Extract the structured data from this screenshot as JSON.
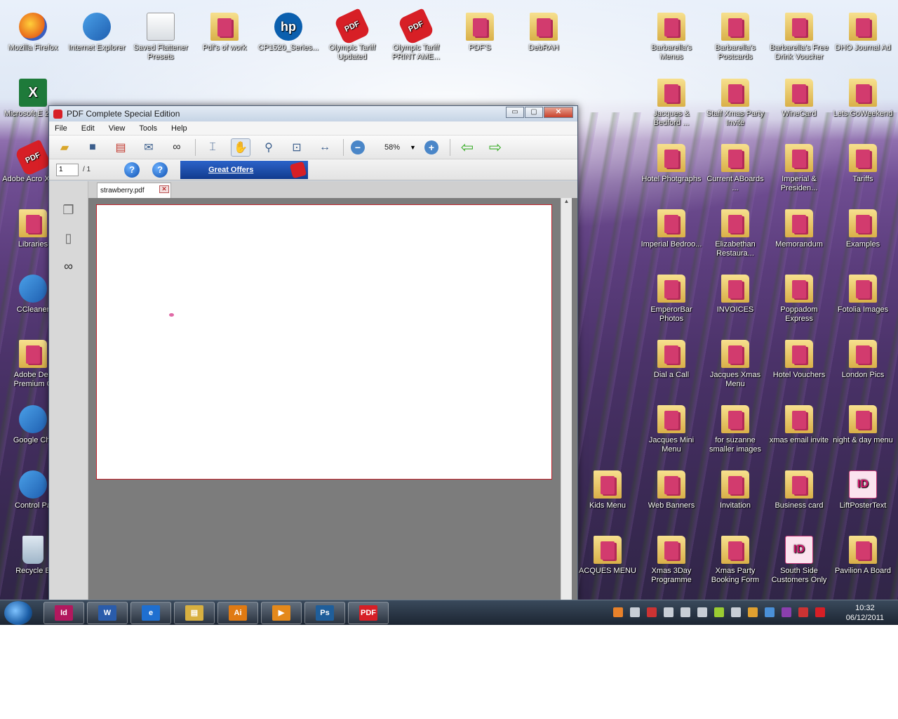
{
  "window": {
    "title": "PDF Complete Special Edition",
    "menu": [
      "File",
      "Edit",
      "View",
      "Tools",
      "Help"
    ],
    "zoom": "58%",
    "page_number": "1",
    "page_total": "/ 1",
    "offers_label": "Great Offers",
    "tab_name": "strawberry.pdf",
    "close_glyph": "✕",
    "min_glyph": "▭",
    "max_glyph": "▢"
  },
  "desktop_icons": [
    {
      "label": "Mozilla Firefox",
      "kind": "ff"
    },
    {
      "label": "Internet Explorer",
      "kind": "app"
    },
    {
      "label": "Saved Flattener Presets",
      "kind": "gen"
    },
    {
      "label": "Pdf's of work",
      "kind": "folder"
    },
    {
      "label": "CP1520_Series...",
      "kind": "hp"
    },
    {
      "label": "Olympic Tariff Updated",
      "kind": "pdf"
    },
    {
      "label": "Olympic Tariff PRINT AME...",
      "kind": "pdf"
    },
    {
      "label": "PDF'S",
      "kind": "folder"
    },
    {
      "label": "DebRAH",
      "kind": "folder"
    },
    {
      "label": "Barbarella's Menus",
      "kind": "folder"
    },
    {
      "label": "Barbarella's Postcards",
      "kind": "folder"
    },
    {
      "label": "Barbarella's Free Drink Voucher",
      "kind": "folder"
    },
    {
      "label": "DHO Journal Ad",
      "kind": "folder"
    },
    {
      "label": "Microsoft E 2010",
      "kind": "xl"
    },
    {
      "label": "Jacques & Bedford ...",
      "kind": "folder"
    },
    {
      "label": "Staff Xmas Party Invite",
      "kind": "folder"
    },
    {
      "label": "WineCard",
      "kind": "folder"
    },
    {
      "label": "Lets GoWeekend",
      "kind": "folder"
    },
    {
      "label": "Adobe Acro X Pro",
      "kind": "pdf"
    },
    {
      "label": "Hotel Photgraphs",
      "kind": "folder"
    },
    {
      "label": "Current ABoards ...",
      "kind": "folder"
    },
    {
      "label": "Imperial & Presiden...",
      "kind": "folder"
    },
    {
      "label": "Tariffs",
      "kind": "folder"
    },
    {
      "label": "Libraries",
      "kind": "folder"
    },
    {
      "label": "Imperial Bedroo...",
      "kind": "folder"
    },
    {
      "label": "Elizabethan Restaura...",
      "kind": "folder"
    },
    {
      "label": "Memorandum",
      "kind": "folder"
    },
    {
      "label": "Examples",
      "kind": "folder"
    },
    {
      "label": "CCleaner",
      "kind": "app"
    },
    {
      "label": "EmperorBar Photos",
      "kind": "folder"
    },
    {
      "label": "INVOICES",
      "kind": "folder"
    },
    {
      "label": "Poppadom Express",
      "kind": "folder"
    },
    {
      "label": "Fotolia Images",
      "kind": "folder"
    },
    {
      "label": "Adobe Des Premium C",
      "kind": "folder"
    },
    {
      "label": "Dial a Call",
      "kind": "folder"
    },
    {
      "label": "Jacques Xmas Menu",
      "kind": "folder"
    },
    {
      "label": "Hotel Vouchers",
      "kind": "folder"
    },
    {
      "label": "London Pics",
      "kind": "folder"
    },
    {
      "label": "Google Chr",
      "kind": "app"
    },
    {
      "label": "Jacques Mini Menu",
      "kind": "folder"
    },
    {
      "label": "for suzanne smaller images",
      "kind": "folder"
    },
    {
      "label": "xmas email invite",
      "kind": "folder"
    },
    {
      "label": "night & day menu",
      "kind": "folder"
    },
    {
      "label": "Control Pa",
      "kind": "app"
    },
    {
      "label": "Kids Menu",
      "kind": "folder"
    },
    {
      "label": "Web Banners",
      "kind": "folder"
    },
    {
      "label": "Invitation",
      "kind": "folder"
    },
    {
      "label": "Business card",
      "kind": "folder"
    },
    {
      "label": "LiftPosterText",
      "kind": "id"
    },
    {
      "label": "Recycle B",
      "kind": "bin"
    },
    {
      "label": "ACQUES MENU",
      "kind": "folder"
    },
    {
      "label": "Xmas 3Day Programme",
      "kind": "folder"
    },
    {
      "label": "Xmas Party Booking Form",
      "kind": "folder"
    },
    {
      "label": "South Side Customers Only",
      "kind": "id"
    },
    {
      "label": "Pavilion A Board",
      "kind": "folder"
    }
  ],
  "taskbar": {
    "items": [
      {
        "name": "indesign-taskbar-item",
        "text": "Id",
        "color": "#b2185e"
      },
      {
        "name": "word-taskbar-item",
        "text": "W",
        "color": "#2a5cab"
      },
      {
        "name": "ie-taskbar-item",
        "text": "e",
        "color": "#1f6fd0"
      },
      {
        "name": "explorer-taskbar-item",
        "text": "▤",
        "color": "#d8b040"
      },
      {
        "name": "illustrator-taskbar-item",
        "text": "Ai",
        "color": "#e07a12"
      },
      {
        "name": "media-taskbar-item",
        "text": "▶",
        "color": "#e4891b"
      },
      {
        "name": "photoshop-taskbar-item",
        "text": "Ps",
        "color": "#1f5e9a"
      },
      {
        "name": "pdf-taskbar-item",
        "text": "PDF",
        "color": "#d71f26"
      }
    ],
    "time": "10:32",
    "date": "06/12/2011"
  }
}
